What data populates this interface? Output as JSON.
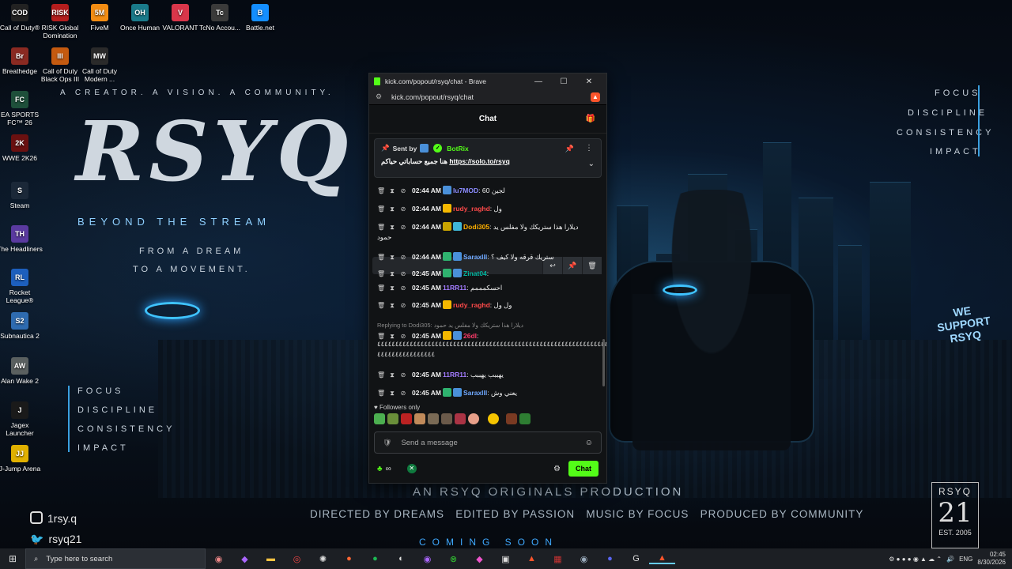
{
  "desktop": {
    "icons": [
      {
        "label": "Call of Duty®",
        "abbr": "COD",
        "color": "#222"
      },
      {
        "label": "RISK Global Domination",
        "abbr": "RISK",
        "color": "#b31d1d"
      },
      {
        "label": "FiveM",
        "abbr": "5M",
        "color": "#f28c13"
      },
      {
        "label": "Once Human",
        "abbr": "OH",
        "color": "#1a7a8a"
      },
      {
        "label": "VALORANT",
        "abbr": "V",
        "color": "#d9364a"
      },
      {
        "label": "TcNo Accou...",
        "abbr": "Tc",
        "color": "#3a3a3a"
      },
      {
        "label": "Battle.net",
        "abbr": "B",
        "color": "#148eff"
      },
      {
        "label": "Breathedge",
        "abbr": "Br",
        "color": "#8a2a22"
      },
      {
        "label": "Call of Duty Black Ops III",
        "abbr": "III",
        "color": "#c45a10"
      },
      {
        "label": "Call of Duty Modern ...",
        "abbr": "MW",
        "color": "#2a2a2a"
      },
      {
        "label": "EA SPORTS FC™ 26",
        "abbr": "FC",
        "color": "#1e4f3a"
      },
      {
        "label": "WWE 2K26",
        "abbr": "2K",
        "color": "#6a1010"
      },
      {
        "label": "Steam",
        "abbr": "S",
        "color": "#1b2838"
      },
      {
        "label": "The Headliners",
        "abbr": "TH",
        "color": "#5a3aa0"
      },
      {
        "label": "Rocket League®",
        "abbr": "RL",
        "color": "#1d5fbd"
      },
      {
        "label": "Subnautica 2",
        "abbr": "S2",
        "color": "#2e6bb0"
      },
      {
        "label": "Alan Wake 2",
        "abbr": "AW",
        "color": "#5a6060"
      },
      {
        "label": "Jagex Launcher",
        "abbr": "J",
        "color": "#1a1a1a"
      },
      {
        "label": "J-Jump Arena",
        "abbr": "JJ",
        "color": "#e0b000"
      }
    ]
  },
  "poster": {
    "tagline": "A CREATOR. A VISION. A COMMUNITY.",
    "logo": "RSYQ",
    "sub": "BEYOND THE STREAM",
    "dream1": "FROM A DREAM",
    "dream2": "TO A MOVEMENT.",
    "values": [
      "FOCUS",
      "DISCIPLINE",
      "CONSISTENCY",
      "IMPACT"
    ],
    "originals": "AN RSYQ ORIGINALS PRODUCTION",
    "credits": "DIRECTED BY DREAMS   EDITED BY PASSION   MUSIC BY FOCUS   PRODUCED BY COMMUNITY",
    "coming": "COMING SOON",
    "support": "WE SUPPORT RSYQ",
    "badge_top": "RSYQ",
    "badge_num": "21",
    "badge_est": "EST. 2005",
    "instagram": "1rsy.q",
    "twitter": "rsyq21"
  },
  "browser": {
    "title": "kick.com/popout/rsyq/chat - Brave",
    "url": "kick.com/popout/rsyq/chat",
    "chat_title": "Chat",
    "pinned": {
      "sent_by": "Sent by",
      "bot": "BotRix",
      "text": "هنا جميع حساباتي حياكم",
      "link": "https://solo.to/rsyq"
    },
    "messages": [
      {
        "time": "02:44 AM",
        "user": "lu7MOD",
        "color": "#8c8cff",
        "text": "لجين 60",
        "badges": [
          "#4a90d9"
        ]
      },
      {
        "time": "02:44 AM",
        "user": "rudy_raghd",
        "color": "#ff4a4a",
        "text": "ول",
        "badges": [
          "#f5b800"
        ]
      },
      {
        "time": "02:44 AM",
        "user": "Dodi305",
        "color": "#ffb000",
        "text": "ديلارا هذا ستريكك ولا مفلس يد",
        "badges": [
          "#c9a400",
          "#3fb6d6"
        ],
        "cont": "حمود"
      },
      {
        "time": "02:44 AM",
        "user": "Saraxlll",
        "color": "#6fa8ff",
        "text": "ستريك قرقه ولا كيف ؟",
        "badges": [
          "#2fb36f",
          "#4a90d9"
        ]
      },
      {
        "time": "02:45 AM",
        "user": "Zinat04",
        "color": "#00b5a0",
        "text": "",
        "badges": [
          "#2fb36f",
          "#4a90d9"
        ]
      },
      {
        "time": "02:45 AM",
        "user": "11RR11",
        "color": "#a37cff",
        "text": "احسكمممم",
        "badges": []
      },
      {
        "time": "02:45 AM",
        "user": "rudy_raghd",
        "color": "#ff4a4a",
        "text": "ول ول",
        "badges": [
          "#f5b800"
        ]
      },
      {
        "time": "02:45 AM",
        "user": "26dl",
        "color": "#ff3b6a",
        "text": "",
        "badges": [
          "#f5b800",
          "#4a90d9"
        ],
        "reply": "Replying to Dodi305: ديلارا هذا ستريكك ولا مفلس يد حمود"
      },
      {
        "time": "02:45 AM",
        "user": "11RR11",
        "color": "#a37cff",
        "text": "يهببب يهببب",
        "badges": []
      },
      {
        "time": "02:45 AM",
        "user": "Saraxlll",
        "color": "#6fa8ff",
        "text": "يعني وش",
        "badges": [
          "#2fb36f",
          "#4a90d9"
        ]
      }
    ],
    "spam_line": "٤٤٤٤٤٤٤٤٤٤٤٤٤٤٤٤٤٤٤٤٤٤٤٤٤٤٤٤٤٤٤٤٤٤٤٤٤٤٤٤٤٤٤٤٤٤٤٤٤٤٤٤٤٤٤٤٤٤٤٤٤٤٤٤",
    "spam_line2": "٤٤٤٤٤٤٤٤٤٤٤٤٤٤٤٤",
    "followers": "Followers only",
    "placeholder": "Send a message",
    "send": "Chat"
  },
  "taskbar": {
    "search": "Type here to search",
    "lang": "ENG",
    "time": "02:45",
    "date": "8/30/2026"
  }
}
